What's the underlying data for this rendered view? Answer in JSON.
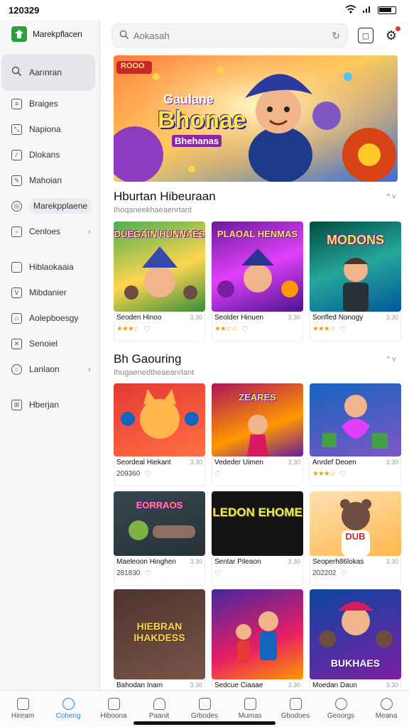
{
  "status": {
    "time": "120329",
    "signal": "▴▴",
    "wifi": "⁑"
  },
  "sidebar": {
    "brand": "Marekpflacen",
    "items": [
      {
        "label": "Aarınran",
        "icon": "search-icon"
      },
      {
        "label": "Braiges",
        "icon": "list-icon"
      },
      {
        "label": "Napiona",
        "icon": "expand-icon"
      },
      {
        "label": "Dlokans",
        "icon": "edit-icon"
      },
      {
        "label": "Mahoian",
        "icon": "pen-icon"
      },
      {
        "label": "Marekpplaene",
        "icon": "marketplace-icon"
      },
      {
        "label": "Cenloes",
        "icon": "image-icon"
      },
      {
        "label": "Hiblaokaaia",
        "icon": "square-icon"
      },
      {
        "label": "Mibdanier",
        "icon": "shield-icon"
      },
      {
        "label": "Aolepboesgy",
        "icon": "home-icon"
      },
      {
        "label": "Senoiel",
        "icon": "close-box-icon"
      },
      {
        "label": "Lanlaon",
        "icon": "circle-icon"
      },
      {
        "label": "Hberjan",
        "icon": "table-icon"
      }
    ]
  },
  "search": {
    "placeholder": "Aokasah"
  },
  "hero": {
    "title_top": "Gaulane",
    "title_main": "Bhonae",
    "title_sub": "Bhehanas",
    "corner": "ROOO"
  },
  "sections": [
    {
      "title": "Hburtan Hibeuraan",
      "subtitle": "Ihoqaneekhaeaenrtant",
      "more": "⌃˅",
      "cards": [
        {
          "name": "Seoden Hinoo",
          "size": "3.30",
          "stars": "★★★☆",
          "art_title": "DUEGAIN HUNNAES"
        },
        {
          "name": "Seolder Hinuen",
          "size": "3.30",
          "stars": "★★☆☆",
          "art_title": "PLAOAL HENMAS"
        },
        {
          "name": "Sonfled Nonogy",
          "size": "3.30",
          "stars": "★★★☆",
          "art_title": "MODONS"
        }
      ]
    },
    {
      "title": "Bh Gaouring",
      "subtitle": "Ihugaenedtheaeanrlant",
      "more": "⌃˅",
      "cards": [
        {
          "name": "Seordeal Hiekant",
          "size": "3.30",
          "line2": "209360",
          "art_title": ""
        },
        {
          "name": "Vededer Uimen",
          "size": "3.30",
          "line2": "",
          "art_title": "ZEARES"
        },
        {
          "name": "Anrdef Deoen",
          "size": "3.30",
          "stars": "★★★☆",
          "art_title": ""
        },
        {
          "name": "Maeleoon Hinghen",
          "size": "3.30",
          "line2": "281830",
          "art_title": "EORRAOS"
        },
        {
          "name": "Sentar Pileaon",
          "size": "3.30",
          "line2": "",
          "art_title": "LEDON EHOME"
        },
        {
          "name": "Seoperh86lokas",
          "size": "3.30",
          "line2": "202202",
          "art_title": "DUB"
        },
        {
          "name": "Bahodan Inam",
          "size": "3.30",
          "art_title": "HIEBRAN IHAKDESS"
        },
        {
          "name": "Sedcue Ciaaae",
          "size": "3.30",
          "art_title": ""
        },
        {
          "name": "Moedan Daun",
          "size": "3.30",
          "art_title": "BUKHAES"
        }
      ]
    }
  ],
  "bottom_nav": [
    {
      "label": "Hiream",
      "icon": "home-icon"
    },
    {
      "label": "Coheng",
      "icon": "search-icon"
    },
    {
      "label": "Hiboona",
      "icon": "image-icon"
    },
    {
      "label": "Paanit",
      "icon": "bell-icon"
    },
    {
      "label": "Grbodes",
      "icon": "chart-icon"
    },
    {
      "label": "Mumas",
      "icon": "bookmark-icon"
    },
    {
      "label": "Gbodoes",
      "icon": "mail-icon"
    },
    {
      "label": "Geoorgs",
      "icon": "search-icon"
    },
    {
      "label": "Meana",
      "icon": "user-icon"
    }
  ]
}
